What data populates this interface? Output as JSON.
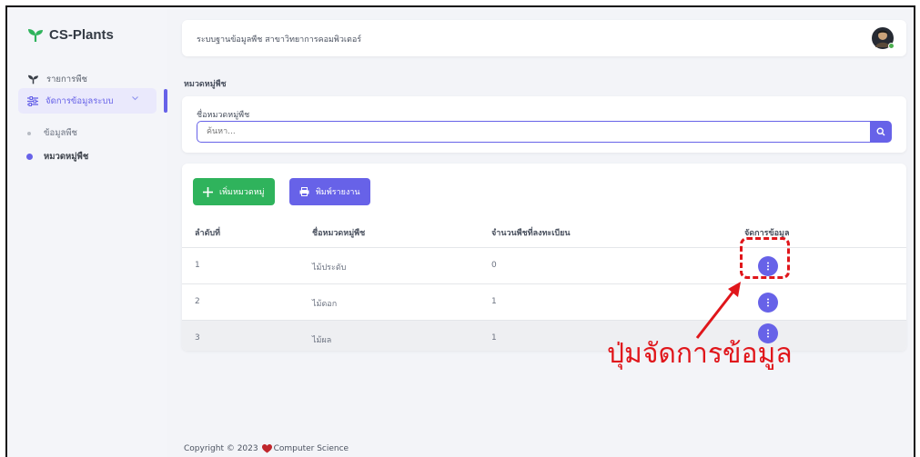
{
  "brand": {
    "name": "CS-Plants"
  },
  "sidebar": {
    "items": [
      {
        "label": "รายการพืช"
      },
      {
        "label": "จัดการข้อมูลระบบ"
      }
    ],
    "subitems": [
      {
        "label": "ข้อมูลพืช"
      },
      {
        "label": "หมวดหมู่พืช"
      }
    ]
  },
  "topbar": {
    "title": "ระบบฐานข้อมูลพืช สาขาวิทยาการคอมพิวเตอร์"
  },
  "breadcrumb": "หมวดหมู่พืช",
  "search": {
    "label": "ชื่อหมวดหมู่พืช",
    "placeholder": "ค้นหา..."
  },
  "toolbar": {
    "add_label": "เพิ่มหมวดหมู่",
    "print_label": "พิมพ์รายงาน"
  },
  "table": {
    "headers": [
      "ลำดับที่",
      "ชื่อหมวดหมู่พืช",
      "จำนวนพืชที่ลงทะเบียน",
      "จัดการข้อมูล"
    ],
    "rows": [
      [
        "1",
        "ไม้ประดับ",
        "0"
      ],
      [
        "2",
        "ไม้ดอก",
        "1"
      ],
      [
        "3",
        "ไม้ผล",
        "1"
      ]
    ]
  },
  "footer": {
    "prefix": "Copyright © 2023",
    "suffix": "Computer Science"
  },
  "annotation": {
    "text": "ปุ่มจัดการข้อมูล"
  },
  "colors": {
    "accent": "#6762e8",
    "success": "#2fb35c",
    "annotation": "#e0161b"
  }
}
